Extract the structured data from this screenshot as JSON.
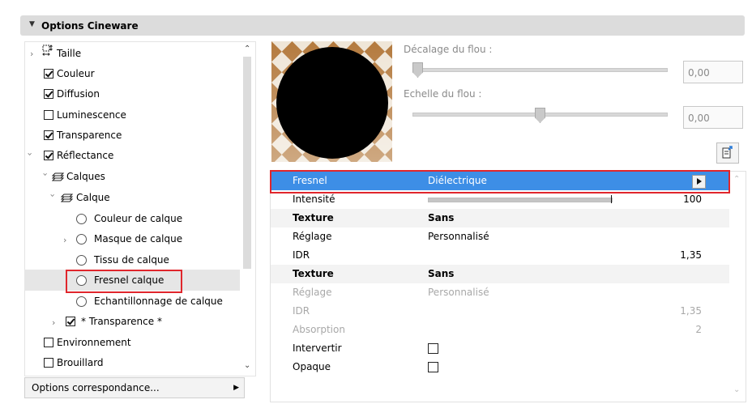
{
  "header": {
    "title": "Options Cineware"
  },
  "tree": {
    "items": [
      {
        "label": "Taille",
        "icon": "resize-icon"
      },
      {
        "label": "Couleur",
        "checked": true
      },
      {
        "label": "Diffusion",
        "checked": true
      },
      {
        "label": "Luminescence",
        "checked": false
      },
      {
        "label": "Transparence",
        "checked": true
      },
      {
        "label": "Réflectance",
        "checked": true
      },
      {
        "label": "Calques",
        "icon": "layers-icon"
      },
      {
        "label": "Calque",
        "icon": "layers-icon"
      },
      {
        "label": "Couleur de calque"
      },
      {
        "label": "Masque de calque"
      },
      {
        "label": "Tissu de calque"
      },
      {
        "label": "Fresnel calque",
        "selected": true
      },
      {
        "label": "Echantillonnage de calque"
      },
      {
        "label": "* Transparence *",
        "checked": true
      },
      {
        "label": "Environnement",
        "checked": false
      },
      {
        "label": "Brouillard",
        "checked": false
      }
    ],
    "bottom_button": "Options correspondance..."
  },
  "sliders": {
    "offset_label": "Décalage du flou :",
    "offset_value": "0,00",
    "offset_position": 0.0,
    "scale_label": "Echelle du flou :",
    "scale_value": "0,00",
    "scale_position": 0.5
  },
  "grid": {
    "rows": [
      {
        "name": "Fresnel",
        "value": "Diélectrique",
        "num": ""
      },
      {
        "name": "Intensité",
        "value": "",
        "num": "100"
      },
      {
        "name": "Texture",
        "value": "Sans",
        "num": ""
      },
      {
        "name": "Réglage",
        "value": "Personnalisé",
        "num": ""
      },
      {
        "name": "IDR",
        "value": "",
        "num": "1,35"
      },
      {
        "name": "Texture",
        "value": "Sans",
        "num": ""
      },
      {
        "name": "Réglage",
        "value": "Personnalisé",
        "num": ""
      },
      {
        "name": "IDR",
        "value": "",
        "num": "1,35"
      },
      {
        "name": "Absorption",
        "value": "",
        "num": "2"
      },
      {
        "name": "Intervertir",
        "value": "",
        "num": ""
      },
      {
        "name": "Opaque",
        "value": "",
        "num": ""
      }
    ],
    "intensity_fraction": 1.0
  },
  "colors": {
    "selection": "#3d8ee6",
    "highlight_border": "#e0262c"
  }
}
